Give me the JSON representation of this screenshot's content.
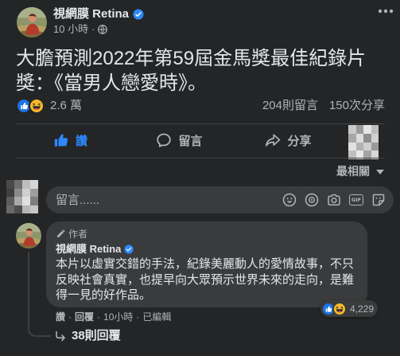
{
  "colors": {
    "background": "#242526",
    "text": "#e4e6eb",
    "secondary_text": "#b0b3b8",
    "accent": "#2d88ff",
    "surface": "#3a3b3c",
    "divider": "#3e4042"
  },
  "post": {
    "author": {
      "name": "視網膜 Retina",
      "verified": true
    },
    "timestamp": "10 小時",
    "separator": "·",
    "audience_icon": "globe-icon",
    "menu_icon": "more-icon",
    "text": "大膽預測2022年第59屆金馬獎最佳紀錄片獎：《當男人戀愛時》。",
    "reactions": {
      "icons": [
        "like-icon",
        "haha-icon"
      ],
      "count": "2.6 萬"
    },
    "comments": "204則留言",
    "shares": "150次分享"
  },
  "actions": [
    {
      "label": "讚",
      "icon": "like-icon",
      "active": true
    },
    {
      "label": "留言",
      "icon": "comment-icon",
      "active": false
    },
    {
      "label": "分享",
      "icon": "share-icon",
      "active": false
    }
  ],
  "sort": {
    "label": "最相關",
    "icon": "caret-down-icon"
  },
  "composer": {
    "placeholder": "留言......",
    "icons": [
      "avatar-sticker-icon",
      "emoji-icon",
      "camera-icon",
      "gif-icon",
      "sticker-icon"
    ],
    "gif_label": "GIF"
  },
  "comment": {
    "badge": "作者",
    "badge_icon": "pen-icon",
    "author": "視網膜 Retina",
    "verified": true,
    "text": "本片以虛實交錯的手法，紀錄美麗動人的愛情故事，不只反映社會真實，也提早向大眾預示世界未來的走向，是難得一見的好作品。",
    "reactions": {
      "icons": [
        "like-icon",
        "haha-icon"
      ],
      "count": "4,229"
    },
    "meta": {
      "like": "讚",
      "reply": "回覆",
      "time": "10小時",
      "edited": "已編輯",
      "separator": "·"
    },
    "replies": "38則回覆"
  }
}
